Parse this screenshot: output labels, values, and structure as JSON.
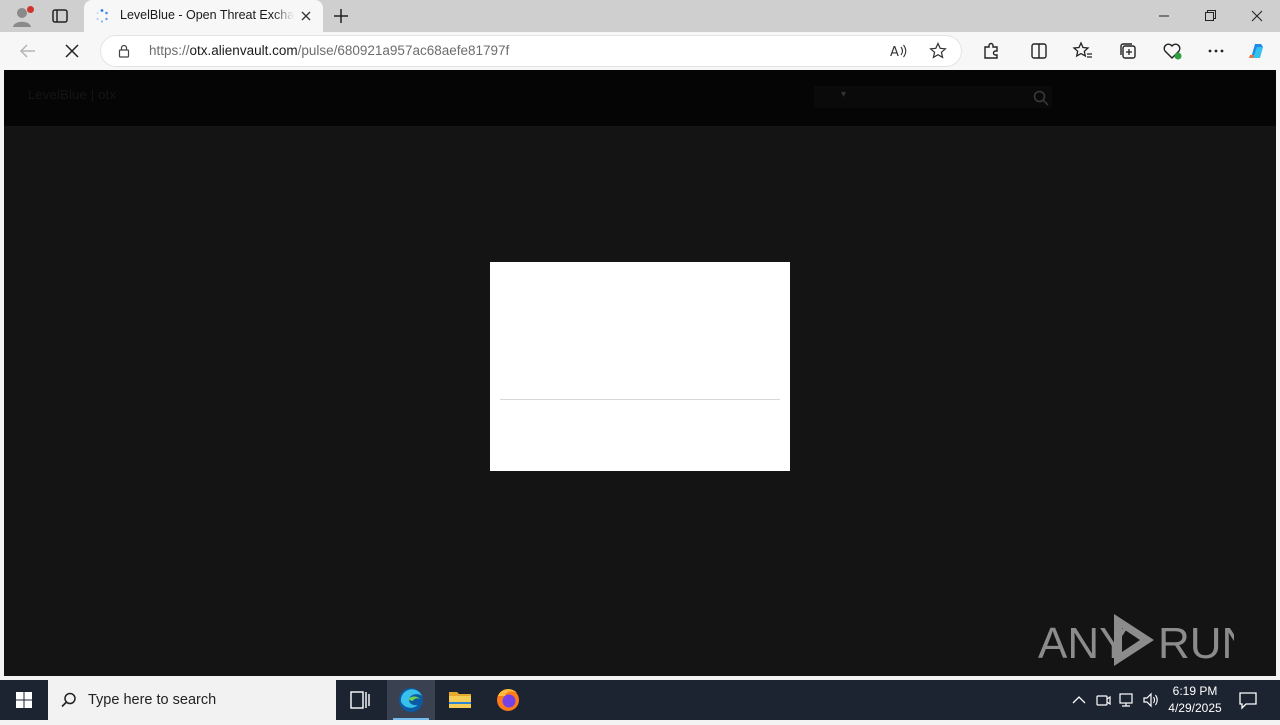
{
  "browser": {
    "tab": {
      "title": "LevelBlue - Open Threat Exchange"
    },
    "address": {
      "scheme": "https://",
      "host": "otx.alienvault.com",
      "path": "/pulse/680921a957ac68aefe81797f"
    }
  },
  "page": {
    "header": {
      "logo_text": "LevelBlue | otx",
      "search_placeholder": ""
    },
    "watermark": "ANY RUN"
  },
  "taskbar": {
    "search_placeholder": "Type here to search",
    "time": "6:19 PM",
    "date": "4/29/2025"
  },
  "colors": {
    "page_bg": "#141414",
    "header_bg": "#050505",
    "taskbar_bg": "#1c2331",
    "accent": "#0078d4"
  }
}
